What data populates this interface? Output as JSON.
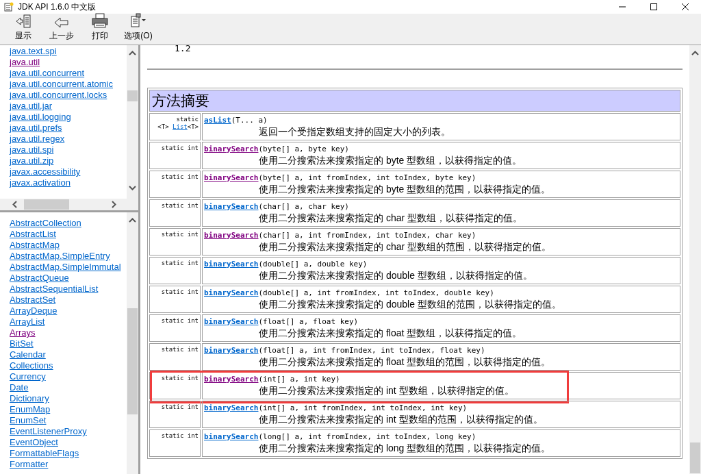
{
  "window": {
    "title": "JDK API 1.6.0 中文版"
  },
  "toolbar": [
    {
      "kind": "show",
      "label": "显示"
    },
    {
      "kind": "back",
      "label": "上一步"
    },
    {
      "kind": "print",
      "label": "打印"
    },
    {
      "kind": "options",
      "label": "选项(O)"
    }
  ],
  "packages": [
    {
      "name": "java.text.spi",
      "visited": false
    },
    {
      "name": "java.util",
      "visited": true
    },
    {
      "name": "java.util.concurrent",
      "visited": false
    },
    {
      "name": "java.util.concurrent.atomic",
      "visited": false
    },
    {
      "name": "java.util.concurrent.locks",
      "visited": false
    },
    {
      "name": "java.util.jar",
      "visited": false
    },
    {
      "name": "java.util.logging",
      "visited": false
    },
    {
      "name": "java.util.prefs",
      "visited": false
    },
    {
      "name": "java.util.regex",
      "visited": false
    },
    {
      "name": "java.util.spi",
      "visited": false
    },
    {
      "name": "java.util.zip",
      "visited": false
    },
    {
      "name": "javax.accessibility",
      "visited": false
    },
    {
      "name": "javax.activation",
      "visited": false
    }
  ],
  "classes": [
    {
      "name": "AbstractCollection",
      "visited": false
    },
    {
      "name": "AbstractList",
      "visited": false
    },
    {
      "name": "AbstractMap",
      "visited": false
    },
    {
      "name": "AbstractMap.SimpleEntry",
      "visited": false
    },
    {
      "name": "AbstractMap.SimpleImmutal",
      "visited": false
    },
    {
      "name": "AbstractQueue",
      "visited": false
    },
    {
      "name": "AbstractSequentialList",
      "visited": false
    },
    {
      "name": "AbstractSet",
      "visited": false
    },
    {
      "name": "ArrayDeque",
      "visited": false
    },
    {
      "name": "ArrayList",
      "visited": false
    },
    {
      "name": "Arrays",
      "visited": true
    },
    {
      "name": "BitSet",
      "visited": false
    },
    {
      "name": "Calendar",
      "visited": false
    },
    {
      "name": "Collections",
      "visited": false
    },
    {
      "name": "Currency",
      "visited": false
    },
    {
      "name": "Date",
      "visited": false
    },
    {
      "name": "Dictionary",
      "visited": false
    },
    {
      "name": "EnumMap",
      "visited": false
    },
    {
      "name": "EnumSet",
      "visited": false
    },
    {
      "name": "EventListenerProxy",
      "visited": false
    },
    {
      "name": "EventObject",
      "visited": false
    },
    {
      "name": "FormattableFlags",
      "visited": false
    },
    {
      "name": "Formatter",
      "visited": false
    }
  ],
  "content": {
    "since": "1.2",
    "section_title": "方法摘要",
    "methods": [
      {
        "modifier": "static",
        "generic": {
          "before": "<T>",
          "link": "List",
          "after": "<T>"
        },
        "name": "asList",
        "params": "(T... a)",
        "description": "返回一个受指定数组支持的固定大小的列表。",
        "visited": false,
        "highlighted": false
      },
      {
        "modifier": "static int",
        "name": "binarySearch",
        "params": "(byte[] a, byte key)",
        "description": "使用二分搜索法来搜索指定的 byte 型数组，以获得指定的值。",
        "visited": true,
        "highlighted": false
      },
      {
        "modifier": "static int",
        "name": "binarySearch",
        "params": "(byte[] a, int fromIndex, int toIndex, byte key)",
        "description": "使用二分搜索法来搜索指定的 byte 型数组的范围，以获得指定的值。",
        "visited": true,
        "highlighted": false
      },
      {
        "modifier": "static int",
        "name": "binarySearch",
        "params": "(char[] a, char key)",
        "description": "使用二分搜索法来搜索指定的 char 型数组，以获得指定的值。",
        "visited": false,
        "highlighted": false
      },
      {
        "modifier": "static int",
        "name": "binarySearch",
        "params": "(char[] a, int fromIndex, int toIndex, char key)",
        "description": "使用二分搜索法来搜索指定的 char 型数组的范围，以获得指定的值。",
        "visited": true,
        "highlighted": false
      },
      {
        "modifier": "static int",
        "name": "binarySearch",
        "params": "(double[] a, double key)",
        "description": "使用二分搜索法来搜索指定的 double 型数组，以获得指定的值。",
        "visited": false,
        "highlighted": false
      },
      {
        "modifier": "static int",
        "name": "binarySearch",
        "params": "(double[] a, int fromIndex, int toIndex, double key)",
        "description": "使用二分搜索法来搜索指定的 double 型数组的范围，以获得指定的值。",
        "visited": false,
        "highlighted": false
      },
      {
        "modifier": "static int",
        "name": "binarySearch",
        "params": "(float[] a, float key)",
        "description": "使用二分搜索法来搜索指定的 float 型数组，以获得指定的值。",
        "visited": false,
        "highlighted": false
      },
      {
        "modifier": "static int",
        "name": "binarySearch",
        "params": "(float[] a, int fromIndex, int toIndex, float key)",
        "description": "使用二分搜索法来搜索指定的 float 型数组的范围，以获得指定的值。",
        "visited": false,
        "highlighted": false
      },
      {
        "modifier": "static int",
        "name": "binarySearch",
        "params": "(int[] a, int key)",
        "description": "使用二分搜索法来搜索指定的 int 型数组，以获得指定的值。",
        "visited": true,
        "highlighted": true
      },
      {
        "modifier": "static int",
        "name": "binarySearch",
        "params": "(int[] a, int fromIndex, int toIndex, int key)",
        "description": "使用二分搜索法来搜索指定的 int 型数组的范围，以获得指定的值。",
        "visited": false,
        "highlighted": false
      },
      {
        "modifier": "static int",
        "name": "binarySearch",
        "params": "(long[] a, int fromIndex, int toIndex, long key)",
        "description": "使用二分搜索法来搜索指定的 long 型数组的范围，以获得指定的值。",
        "visited": false,
        "highlighted": false
      }
    ]
  }
}
